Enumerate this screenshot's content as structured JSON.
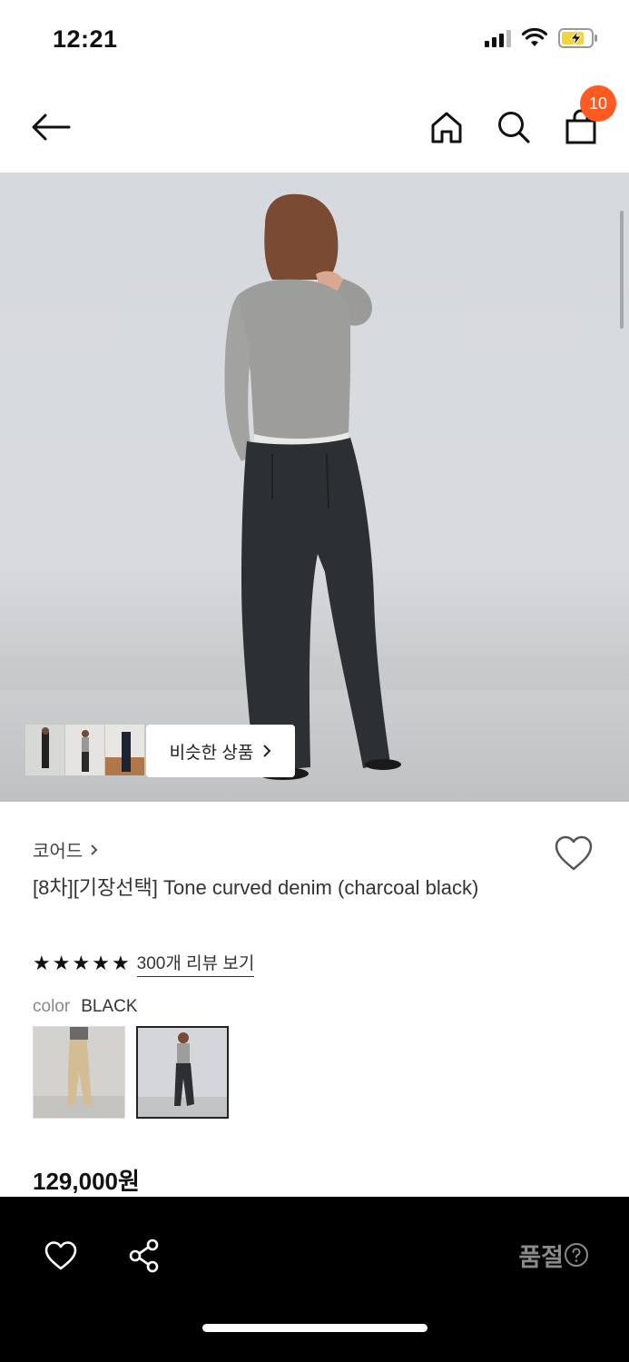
{
  "status_bar": {
    "time": "12:21"
  },
  "nav": {
    "cart_count": "10",
    "icons": [
      "back-arrow-icon",
      "home-icon",
      "search-icon",
      "shopping-bag-icon"
    ]
  },
  "hero": {
    "similar_label": "비슷한 상품",
    "similar_chevron": "›"
  },
  "product": {
    "brand": "코어드",
    "brand_chevron": "›",
    "title": "[8차][기장선택] Tone curved denim (charcoal black)",
    "rating_stars": 5,
    "review_link": "300개 리뷰 보기",
    "color_label": "color",
    "color_value": "BLACK",
    "price": "129,000원"
  },
  "bottom_bar": {
    "sold_out": "품절",
    "help_icon": "question-circle-icon"
  },
  "colors": {
    "badge": "#ff5a1f",
    "bottom_bar": "#000000",
    "sold_out_text": "#8a8a8a"
  }
}
